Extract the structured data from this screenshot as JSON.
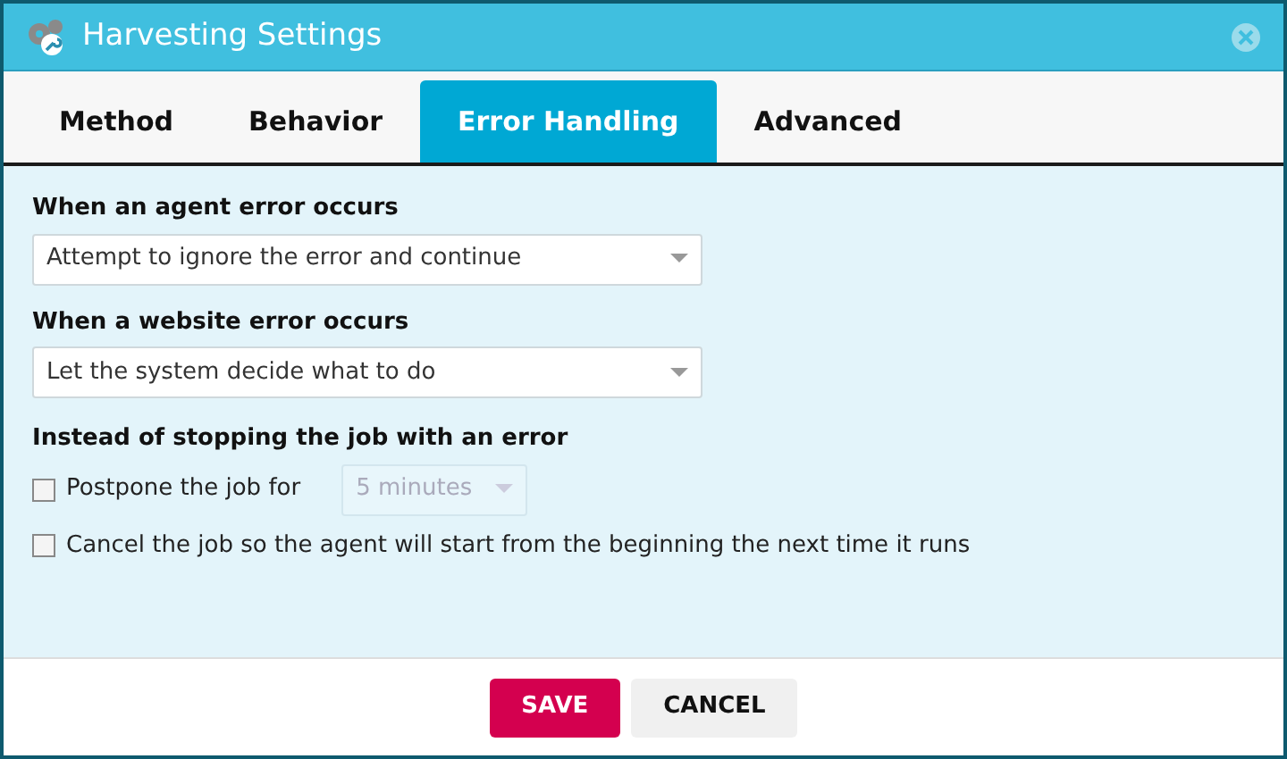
{
  "window": {
    "title": "Harvesting Settings"
  },
  "tabs": [
    {
      "label": "Method",
      "selected": false
    },
    {
      "label": "Behavior",
      "selected": false
    },
    {
      "label": "Error Handling",
      "selected": true
    },
    {
      "label": "Advanced",
      "selected": false
    }
  ],
  "agent_error": {
    "label": "When an agent error occurs",
    "value": "Attempt to ignore the error and continue"
  },
  "website_error": {
    "label": "When a website error occurs",
    "value": "Let the system decide what to do"
  },
  "instead": {
    "label": "Instead of stopping the job with an error",
    "options": [
      {
        "label": "Postpone the job for",
        "checked": false,
        "dropdown": {
          "value": "5 minutes",
          "disabled": true
        }
      },
      {
        "label": "Cancel the job so the agent will start from the beginning the next time it runs",
        "checked": false
      }
    ]
  },
  "buttons": [
    {
      "label": "SAVE",
      "kind": "primary"
    },
    {
      "label": "CANCEL",
      "kind": "secondary"
    }
  ]
}
